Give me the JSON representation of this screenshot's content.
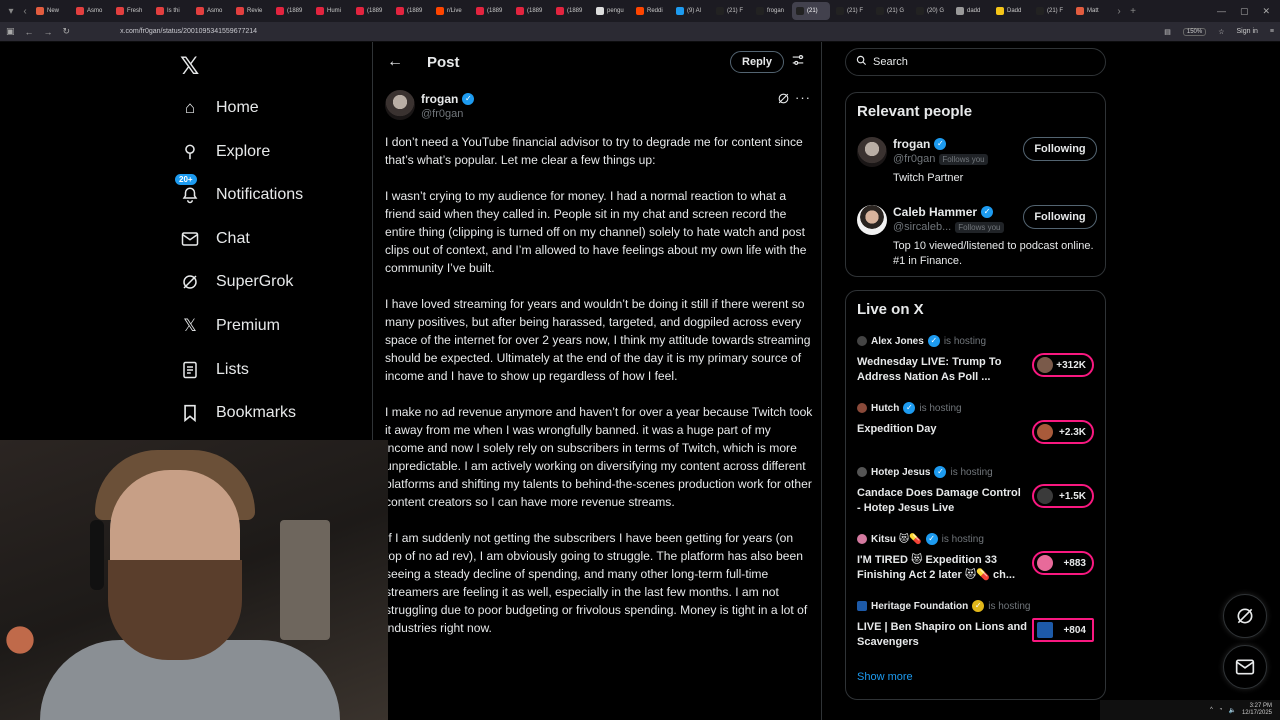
{
  "browser": {
    "tabs": [
      {
        "label": "New",
        "color": "#e25c3f"
      },
      {
        "label": "Asmo",
        "color": "#e23f3f"
      },
      {
        "label": "Fresh",
        "color": "#e23f3f"
      },
      {
        "label": "Is thi",
        "color": "#e23f3f"
      },
      {
        "label": "Asmo",
        "color": "#e23f3f"
      },
      {
        "label": "Revie",
        "color": "#e23f3f"
      },
      {
        "label": "(1889",
        "color": "#e2243f"
      },
      {
        "label": "Humi",
        "color": "#e2243f"
      },
      {
        "label": "(1889",
        "color": "#e2243f"
      },
      {
        "label": "(1889",
        "color": "#e2243f"
      },
      {
        "label": "r/Live",
        "color": "#ff4500"
      },
      {
        "label": "(1889",
        "color": "#e2243f"
      },
      {
        "label": "(1889",
        "color": "#e2243f"
      },
      {
        "label": "(1889",
        "color": "#e2243f"
      },
      {
        "label": "pengu",
        "color": "#dddddd"
      },
      {
        "label": "Reddi",
        "color": "#ff4500"
      },
      {
        "label": "(9) Al",
        "color": "#1d9bf0"
      },
      {
        "label": "(21) F",
        "color": "#222222"
      },
      {
        "label": "frogan",
        "color": "#222222"
      },
      {
        "label": "(21)",
        "color": "#222222",
        "active": true
      },
      {
        "label": "(21) F",
        "color": "#222222"
      },
      {
        "label": "(21) G",
        "color": "#222222"
      },
      {
        "label": "(20) G",
        "color": "#222222"
      },
      {
        "label": "dadd",
        "color": "#999999"
      },
      {
        "label": "Dadd",
        "color": "#f5c518"
      },
      {
        "label": "(21) F",
        "color": "#222222"
      },
      {
        "label": "Matt",
        "color": "#e25c3f"
      }
    ],
    "url": "x.com/fr0gan/status/2001095341559677214",
    "zoom": "150%",
    "sign_in": "Sign in"
  },
  "leftnav": {
    "logo": "𝕏",
    "items": [
      {
        "label": "Home",
        "icon": "home-icon",
        "glyph": "⌂"
      },
      {
        "label": "Explore",
        "icon": "search-icon",
        "glyph": "⚲"
      },
      {
        "label": "Notifications",
        "icon": "bell-icon",
        "glyph": "🔔",
        "badge": "20+"
      },
      {
        "label": "Chat",
        "icon": "mail-icon",
        "glyph": "✉"
      },
      {
        "label": "SuperGrok",
        "icon": "grok-icon",
        "glyph": "⊘"
      },
      {
        "label": "Premium",
        "icon": "x-premium-icon",
        "glyph": "𝕏"
      },
      {
        "label": "Lists",
        "icon": "list-icon",
        "glyph": "☰"
      },
      {
        "label": "Bookmarks",
        "icon": "bookmark-icon",
        "glyph": "🔖"
      }
    ]
  },
  "post": {
    "header_title": "Post",
    "reply_label": "Reply",
    "author_name": "frogan",
    "author_handle": "@fr0gan",
    "paragraphs": [
      "I don’t need a YouTube financial advisor to try to degrade me for content since that’s what’s popular. Let me clear a few things up:",
      "I wasn’t crying to my audience for money. I had a normal reaction to what a friend said when they called in. People sit in my chat and screen record the entire thing (clipping is turned off on my channel) solely to hate watch and post clips out of context, and I’m allowed to have feelings about my own life with the community I’ve built.",
      "I have loved streaming for years and wouldn’t be doing it still if there werent so many positives, but after being harassed, targeted, and dogpiled across every space of the internet for over 2 years now, I think my attitude towards streaming should be expected. Ultimately at the end of the day it is my primary source of income and I have to show up regardless of how I feel.",
      "I make no ad revenue anymore and haven’t for over a year because Twitch took it away from me when I was wrongfully banned. it was a huge part of my income and now I solely rely on subscribers in terms of Twitch, which is more unpredictable. I am actively working on diversifying my content across different platforms and shifting my talents to behind-the-scenes production work for other content creators so I can have more revenue streams.",
      "If I am suddenly not getting the subscribers I have been getting for years (on top of no ad rev), I am obviously going to struggle. The platform has also been seeing a steady decline of spending, and many other long-term full-time streamers are feeling it as well, especially in the last few months. I am not struggling due to poor budgeting or frivolous spending. Money is tight in a lot of industries right now."
    ]
  },
  "search": {
    "placeholder": "Search"
  },
  "relevant": {
    "title": "Relevant people",
    "people": [
      {
        "name": "frogan",
        "handle": "@fr0gan",
        "follows_you": "Follows you",
        "bio": "Twitch Partner",
        "button": "Following",
        "avatar_color": "#5a4a44"
      },
      {
        "name": "Caleb Hammer",
        "handle": "@sircaleb...",
        "follows_you": "Follows you",
        "bio": "Top 10 viewed/listened to podcast online. #1 in Finance.",
        "button": "Following",
        "avatar_color": "#c9c2bb"
      }
    ]
  },
  "live": {
    "title": "Live on X",
    "hosting_label": "is hosting",
    "items": [
      {
        "host": "Alex Jones",
        "title": "Wednesday LIVE: Trump To Address Nation As Poll ...",
        "count": "+312K",
        "host_color": "#444444",
        "count_avatar": "#7a5a4a"
      },
      {
        "host": "Hutch",
        "title": "Expedition Day",
        "count": "+2.3K",
        "host_color": "#8a4a3a",
        "count_avatar": "#a85a3a"
      },
      {
        "host": "Hotep Jesus",
        "title": "Candace Does Damage Control - Hotep Jesus Live",
        "count": "+1.5K",
        "host_color": "#555555",
        "count_avatar": "#3a3a3a"
      },
      {
        "host": "Kitsu 😻💊",
        "title": "I'M TIRED 😻 Expedition 33 Finishing Act 2 later 😻💊 ch...",
        "count": "+883",
        "host_color": "#d47aa0",
        "count_avatar": "#e86a9a"
      },
      {
        "host": "Heritage Foundation",
        "title": "LIVE | Ben Shapiro on Lions and Scavengers",
        "count": "+804",
        "host_color": "#1d5aa8",
        "count_avatar": "#1d5aa8"
      }
    ],
    "show_more": "Show more"
  },
  "tray": {
    "time": "3:27 PM",
    "date": "12/17/2025"
  }
}
